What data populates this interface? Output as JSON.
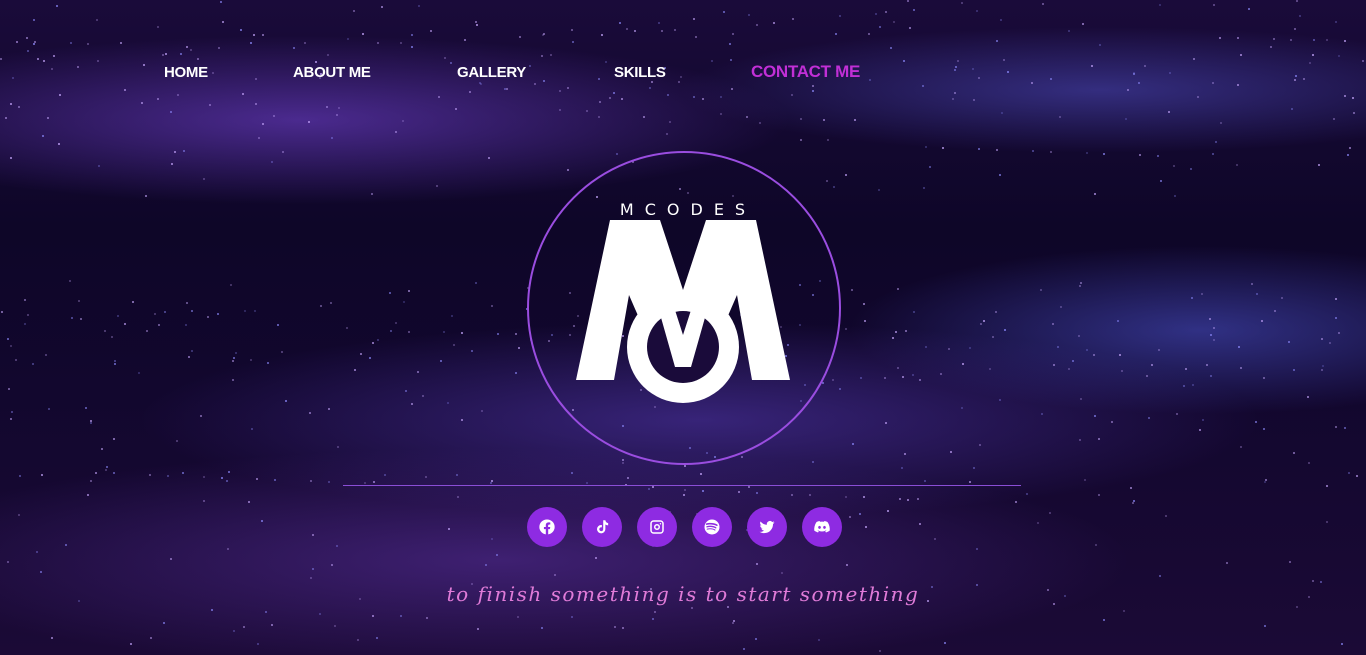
{
  "nav": {
    "items": [
      "HOME",
      "ABOUT ME",
      "GALLERY",
      "SKILLS",
      "CONTACT ME"
    ],
    "active": "CONTACT ME",
    "active_color": "#c12fd6"
  },
  "logo": {
    "brand_text": "MCODES",
    "ring_color": "#9a4de0"
  },
  "social": {
    "button_color": "#8e2be2",
    "icons": [
      "facebook-icon",
      "tiktok-icon",
      "instagram-icon",
      "spotify-icon",
      "twitter-icon",
      "discord-icon"
    ]
  },
  "tagline": "to finish something is to start something",
  "colors": {
    "background": "#0e0628",
    "accent": "#8e2be2",
    "tagline": "#e07bd8"
  }
}
